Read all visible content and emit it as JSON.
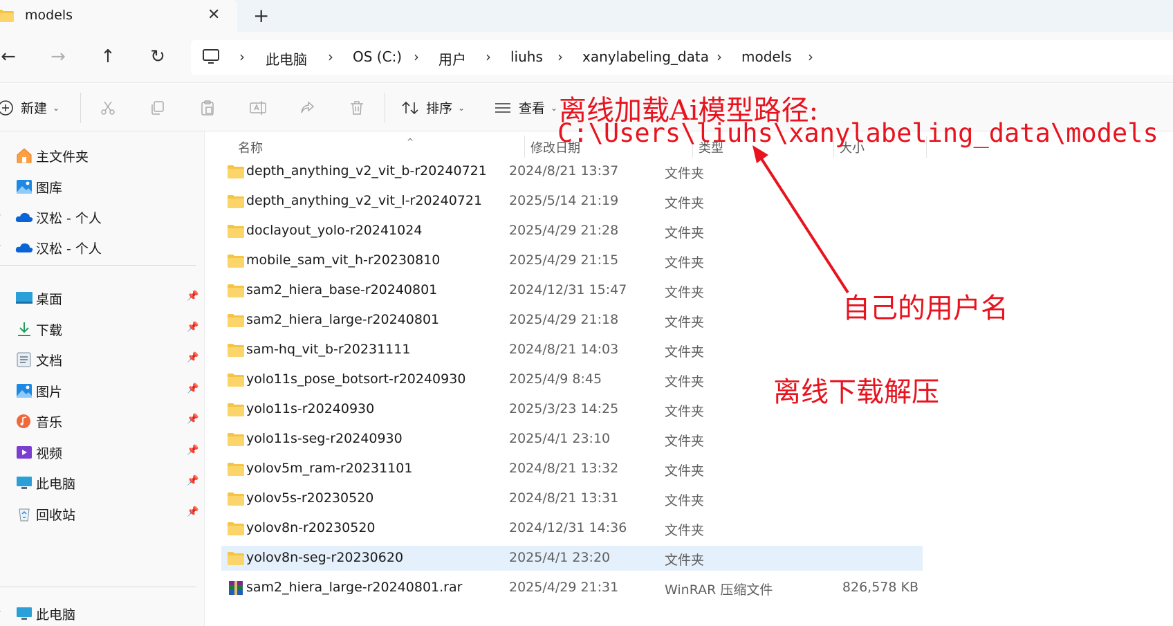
{
  "tab": {
    "title": "models",
    "close_glyph": "✕",
    "new_glyph": "+"
  },
  "nav": {
    "back_glyph": "←",
    "forward_glyph": "→",
    "up_glyph": "↑",
    "refresh_glyph": "↻"
  },
  "breadcrumb": {
    "separator": "›",
    "items": [
      "此电脑",
      "OS (C:)",
      "用户",
      "liuhs",
      "xanylabeling_data",
      "models"
    ]
  },
  "toolbar": {
    "new_label": "新建",
    "sort_label": "排序",
    "view_label": "查看",
    "caret": "⌄",
    "cut_icon": "scissors-icon",
    "copy_icon": "copy-icon",
    "paste_icon": "paste-icon",
    "rename_icon": "rename-icon",
    "share_icon": "share-icon",
    "delete_icon": "trash-icon"
  },
  "sidebar": {
    "pin_glyph": "📌",
    "chevron_glyph": "›",
    "top_items": [
      {
        "label": "主文件夹",
        "icon": "home-icon"
      },
      {
        "label": "图库",
        "icon": "gallery-icon"
      },
      {
        "label": "汉松 - 个人",
        "icon": "onedrive-icon"
      },
      {
        "label": "汉松 - 个人",
        "icon": "onedrive-icon"
      }
    ],
    "pinned_items": [
      {
        "label": "桌面",
        "icon": "desktop-icon"
      },
      {
        "label": "下载",
        "icon": "download-icon"
      },
      {
        "label": "文档",
        "icon": "documents-icon"
      },
      {
        "label": "图片",
        "icon": "pictures-icon"
      },
      {
        "label": "音乐",
        "icon": "music-icon"
      },
      {
        "label": "视频",
        "icon": "videos-icon"
      },
      {
        "label": "此电脑",
        "icon": "this-pc-icon"
      },
      {
        "label": "回收站",
        "icon": "recycle-bin-icon"
      }
    ],
    "bottom_items": [
      {
        "label": "此电脑",
        "icon": "this-pc-icon"
      }
    ]
  },
  "columns": {
    "name": "名称",
    "date": "修改日期",
    "type": "类型",
    "size": "大小",
    "sort_glyph": "^"
  },
  "files": [
    {
      "name": "depth_anything_v2_vit_b-r20240721",
      "date": "2024/8/21 13:37",
      "type": "文件夹",
      "size": ""
    },
    {
      "name": "depth_anything_v2_vit_l-r20240721",
      "date": "2025/5/14 21:19",
      "type": "文件夹",
      "size": ""
    },
    {
      "name": "doclayout_yolo-r20241024",
      "date": "2025/4/29 21:28",
      "type": "文件夹",
      "size": ""
    },
    {
      "name": "mobile_sam_vit_h-r20230810",
      "date": "2025/4/29 21:15",
      "type": "文件夹",
      "size": ""
    },
    {
      "name": "sam2_hiera_base-r20240801",
      "date": "2024/12/31 15:47",
      "type": "文件夹",
      "size": ""
    },
    {
      "name": "sam2_hiera_large-r20240801",
      "date": "2025/4/29 21:18",
      "type": "文件夹",
      "size": ""
    },
    {
      "name": "sam-hq_vit_b-r20231111",
      "date": "2024/8/21 14:03",
      "type": "文件夹",
      "size": ""
    },
    {
      "name": "yolo11s_pose_botsort-r20240930",
      "date": "2025/4/9 8:45",
      "type": "文件夹",
      "size": ""
    },
    {
      "name": "yolo11s-r20240930",
      "date": "2025/3/23 14:25",
      "type": "文件夹",
      "size": ""
    },
    {
      "name": "yolo11s-seg-r20240930",
      "date": "2025/4/1 23:10",
      "type": "文件夹",
      "size": ""
    },
    {
      "name": "yolov5m_ram-r20231101",
      "date": "2024/8/21 13:32",
      "type": "文件夹",
      "size": ""
    },
    {
      "name": "yolov5s-r20230520",
      "date": "2024/8/21 13:31",
      "type": "文件夹",
      "size": ""
    },
    {
      "name": "yolov8n-r20230520",
      "date": "2024/12/31 14:36",
      "type": "文件夹",
      "size": ""
    },
    {
      "name": "yolov8n-seg-r20230620",
      "date": "2025/4/1 23:20",
      "type": "文件夹",
      "size": ""
    },
    {
      "name": "sam2_hiera_large-r20240801.rar",
      "date": "2025/4/29 21:31",
      "type": "WinRAR 压缩文件",
      "size": "826,578 KB"
    }
  ],
  "annotations": {
    "title": "离线加载Ai模型路径:",
    "path": "C:\\Users\\liuhs\\xanylabeling_data\\models",
    "username_note": "自己的用户名",
    "download_note": "离线下载解压",
    "color": "#e8131e"
  }
}
